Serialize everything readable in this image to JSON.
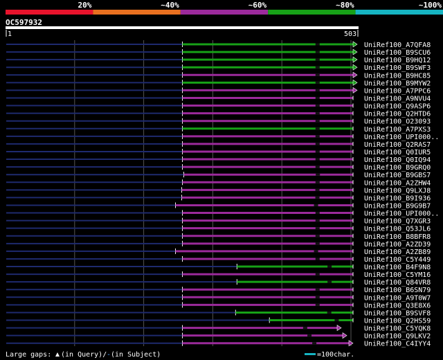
{
  "chart_data": {
    "type": "alignment-overview",
    "query_id": "OC597932",
    "query_length": 503,
    "query_start_label": "1",
    "query_end_label": "503",
    "identity_legend": [
      {
        "label": "20%",
        "color": "#e8132c"
      },
      {
        "label": "~40%",
        "color": "#e87020"
      },
      {
        "label": "~60%",
        "color": "#9b2a9b"
      },
      {
        "label": "~80%",
        "color": "#17a117"
      },
      {
        "label": "~100%",
        "color": "#16b4c2"
      }
    ],
    "hits": [
      {
        "name": "UniRef100_A7QFA8",
        "start": 1,
        "end": 503,
        "aln_start": 256,
        "identity": "~80%",
        "color": "#17a117",
        "arrow": true
      },
      {
        "name": "UniRef100_B9SCU6",
        "start": 1,
        "end": 503,
        "aln_start": 256,
        "identity": "~80%",
        "color": "#17a117",
        "arrow": true
      },
      {
        "name": "UniRef100_B9HQ12",
        "start": 1,
        "end": 503,
        "aln_start": 256,
        "identity": "~80%",
        "color": "#17a117",
        "arrow": true
      },
      {
        "name": "UniRef100_B9SWF3",
        "start": 1,
        "end": 503,
        "aln_start": 256,
        "identity": "~80%",
        "color": "#17a117",
        "arrow": true
      },
      {
        "name": "UniRef100_B9HC85",
        "start": 1,
        "end": 503,
        "aln_start": 256,
        "identity": "~60%",
        "color": "#9b2a9b",
        "arrow": true
      },
      {
        "name": "UniRef100_B9MYW2",
        "start": 1,
        "end": 503,
        "aln_start": 256,
        "identity": "~80%",
        "color": "#17a117",
        "arrow": true
      },
      {
        "name": "UniRef100_A7PPC6",
        "start": 1,
        "end": 503,
        "aln_start": 256,
        "identity": "~60%",
        "color": "#9b2a9b",
        "arrow": true
      },
      {
        "name": "UniRef100_A9NVU4",
        "start": 1,
        "end": 503,
        "aln_start": 256,
        "identity": "~60%",
        "color": "#9b2a9b",
        "arrow": false
      },
      {
        "name": "UniRef100_Q9ASP6",
        "start": 1,
        "end": 503,
        "aln_start": 256,
        "identity": "~60%",
        "color": "#9b2a9b",
        "arrow": false
      },
      {
        "name": "UniRef100_Q2HTD6",
        "start": 1,
        "end": 503,
        "aln_start": 256,
        "identity": "~60%",
        "color": "#9b2a9b",
        "arrow": false
      },
      {
        "name": "UniRef100_O23093",
        "start": 1,
        "end": 503,
        "aln_start": 256,
        "identity": "~60%",
        "color": "#9b2a9b",
        "arrow": false
      },
      {
        "name": "UniRef100_A7PXS3",
        "start": 1,
        "end": 503,
        "aln_start": 256,
        "identity": "~80%",
        "color": "#17a117",
        "arrow": false
      },
      {
        "name": "UniRef100_UPI000..",
        "start": 1,
        "end": 503,
        "aln_start": 256,
        "identity": "~60%",
        "color": "#9b2a9b",
        "arrow": false
      },
      {
        "name": "UniRef100_Q2RAS7",
        "start": 1,
        "end": 503,
        "aln_start": 256,
        "identity": "~60%",
        "color": "#9b2a9b",
        "arrow": false
      },
      {
        "name": "UniRef100_Q0IUR5",
        "start": 1,
        "end": 503,
        "aln_start": 256,
        "identity": "~60%",
        "color": "#9b2a9b",
        "arrow": false
      },
      {
        "name": "UniRef100_Q0IQ94",
        "start": 1,
        "end": 503,
        "aln_start": 256,
        "identity": "~60%",
        "color": "#9b2a9b",
        "arrow": false
      },
      {
        "name": "UniRef100_B9GRQ0",
        "start": 1,
        "end": 503,
        "aln_start": 256,
        "identity": "~60%",
        "color": "#9b2a9b",
        "arrow": false
      },
      {
        "name": "UniRef100_B9GBS7",
        "start": 1,
        "end": 503,
        "aln_start": 258,
        "identity": "~60%",
        "color": "#9b2a9b",
        "arrow": false
      },
      {
        "name": "UniRef100_A2ZHW4",
        "start": 1,
        "end": 503,
        "aln_start": 256,
        "identity": "~60%",
        "color": "#9b2a9b",
        "arrow": false
      },
      {
        "name": "UniRef100_Q9LXJ8",
        "start": 1,
        "end": 503,
        "aln_start": 255,
        "identity": "~60%",
        "color": "#9b2a9b",
        "arrow": false
      },
      {
        "name": "UniRef100_B9I936",
        "start": 1,
        "end": 503,
        "aln_start": 255,
        "identity": "~60%",
        "color": "#9b2a9b",
        "arrow": false
      },
      {
        "name": "UniRef100_B9G9B7",
        "start": 1,
        "end": 503,
        "aln_start": 246,
        "identity": "~60%",
        "color": "#9b2a9b",
        "arrow": false
      },
      {
        "name": "UniRef100_UPI000..",
        "start": 1,
        "end": 503,
        "aln_start": 256,
        "identity": "~60%",
        "color": "#9b2a9b",
        "arrow": false
      },
      {
        "name": "UniRef100_Q7XGR3",
        "start": 1,
        "end": 503,
        "aln_start": 256,
        "identity": "~60%",
        "color": "#9b2a9b",
        "arrow": false
      },
      {
        "name": "UniRef100_Q53JL6",
        "start": 1,
        "end": 503,
        "aln_start": 256,
        "identity": "~60%",
        "color": "#9b2a9b",
        "arrow": false
      },
      {
        "name": "UniRef100_B8BFR8",
        "start": 1,
        "end": 503,
        "aln_start": 256,
        "identity": "~60%",
        "color": "#9b2a9b",
        "arrow": false
      },
      {
        "name": "UniRef100_A2ZD39",
        "start": 1,
        "end": 503,
        "aln_start": 256,
        "identity": "~60%",
        "color": "#9b2a9b",
        "arrow": false
      },
      {
        "name": "UniRef100_A2ZB89",
        "start": 1,
        "end": 503,
        "aln_start": 246,
        "identity": "~60%",
        "color": "#9b2a9b",
        "arrow": false
      },
      {
        "name": "UniRef100_C5Y449",
        "start": 1,
        "end": 503,
        "aln_start": 256,
        "identity": "~60%",
        "color": "#9b2a9b",
        "arrow": false
      },
      {
        "name": "UniRef100_B4F9N8",
        "start": 1,
        "end": 503,
        "aln_start": 335,
        "identity": "~80%",
        "color": "#17a117",
        "arrow": false
      },
      {
        "name": "UniRef100_C5YM16",
        "start": 1,
        "end": 503,
        "aln_start": 256,
        "identity": "~60%",
        "color": "#9b2a9b",
        "arrow": false
      },
      {
        "name": "UniRef100_Q84VR8",
        "start": 1,
        "end": 503,
        "aln_start": 335,
        "identity": "~80%",
        "color": "#17a117",
        "arrow": false
      },
      {
        "name": "UniRef100_B6SN79",
        "start": 1,
        "end": 503,
        "aln_start": 256,
        "identity": "~60%",
        "color": "#9b2a9b",
        "arrow": false
      },
      {
        "name": "UniRef100_A9T0W7",
        "start": 1,
        "end": 503,
        "aln_start": 256,
        "identity": "~60%",
        "color": "#9b2a9b",
        "arrow": false
      },
      {
        "name": "UniRef100_Q3E8X6",
        "start": 1,
        "end": 503,
        "aln_start": 256,
        "identity": "~60%",
        "color": "#9b2a9b",
        "arrow": false
      },
      {
        "name": "UniRef100_B9SVF8",
        "start": 1,
        "end": 503,
        "aln_start": 333,
        "identity": "~80%",
        "color": "#17a117",
        "arrow": false
      },
      {
        "name": "UniRef100_Q2HS59",
        "start": 1,
        "end": 503,
        "aln_start": 382,
        "identity": "~80%",
        "color": "#17a117",
        "arrow": false
      },
      {
        "name": "UniRef100_C5YQK8",
        "start": 1,
        "end": 480,
        "aln_start": 256,
        "identity": "~60%",
        "color": "#9b2a9b",
        "arrow": true
      },
      {
        "name": "UniRef100_Q9LKV2",
        "start": 1,
        "end": 488,
        "aln_start": 256,
        "identity": "~60%",
        "color": "#9b2a9b",
        "arrow": true
      },
      {
        "name": "UniRef100_C4IYY4",
        "start": 1,
        "end": 497,
        "aln_start": 256,
        "identity": "~60%",
        "color": "#9b2a9b",
        "arrow": true
      }
    ],
    "footer": {
      "gaps_label": "Large gaps:",
      "in_query": "(in Query)/",
      "dash": "-",
      "in_subject": " (in Subject)",
      "scale_label": "=100char."
    },
    "colors": {
      "background": "#000000",
      "unaligned": "#1e2a6e",
      "gridline": "#555555",
      "text": "#ffffff",
      "scale_bar": "#16b4c2"
    }
  }
}
